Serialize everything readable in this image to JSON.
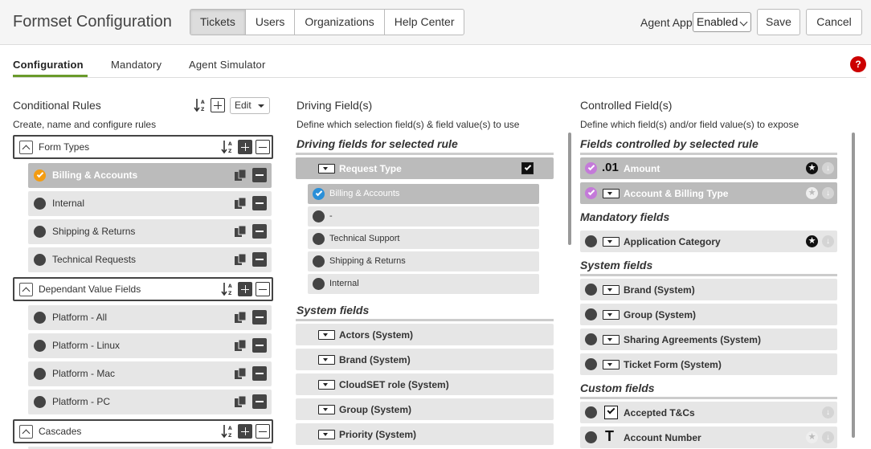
{
  "header": {
    "title": "Formset Configuration",
    "tabs": [
      {
        "label": "Tickets",
        "active": true
      },
      {
        "label": "Users"
      },
      {
        "label": "Organizations"
      },
      {
        "label": "Help Center"
      }
    ],
    "agent_app_label": "Agent App",
    "agent_app_value": "Enabled",
    "save_label": "Save",
    "cancel_label": "Cancel"
  },
  "subtabs": {
    "items": [
      "Configuration",
      "Mandatory",
      "Agent Simulator"
    ],
    "active": "Configuration",
    "help": "?"
  },
  "rules": {
    "title": "Conditional Rules",
    "subtitle": "Create, name and configure rules",
    "edit_label": "Edit",
    "sort_glyph": "A Z",
    "groups": [
      {
        "label": "Form Types",
        "items": [
          "Billing & Accounts",
          "Internal",
          "Shipping & Returns",
          "Technical Requests"
        ]
      },
      {
        "label": "Dependant Value Fields",
        "items": [
          "Platform - All",
          "Platform - Linux",
          "Platform - Mac",
          "Platform - PC"
        ]
      },
      {
        "label": "Cascades",
        "items": []
      }
    ]
  },
  "driving": {
    "title": "Driving Field(s)",
    "subtitle": "Define which selection field(s) & field value(s) to use",
    "selected_section": "Driving fields for selected rule",
    "request_type_label": "Request Type",
    "values": [
      "Billing & Accounts",
      "-",
      "Technical Support",
      "Shipping & Returns",
      "Internal"
    ],
    "system_section": "System fields",
    "system_fields": [
      "Actors (System)",
      "Brand (System)",
      "CloudSET role (System)",
      "Group (System)",
      "Priority (System)"
    ]
  },
  "controlled": {
    "title": "Controlled Field(s)",
    "subtitle": "Define which field(s) and/or field value(s) to expose",
    "selected_section": "Fields controlled by selected rule",
    "selected_fields": [
      {
        "label": "Amount",
        "type_glyph": ".01"
      },
      {
        "label": "Account & Billing Type"
      }
    ],
    "mandatory_section": "Mandatory fields",
    "mandatory_fields": [
      "Application Category"
    ],
    "system_section": "System fields",
    "system_fields": [
      "Brand (System)",
      "Group (System)",
      "Sharing Agreements (System)",
      "Ticket Form (System)"
    ],
    "custom_section": "Custom fields",
    "custom_fields": [
      {
        "label": "Accepted T&Cs"
      },
      {
        "label": "Account Number",
        "type_glyph": "T"
      }
    ]
  },
  "colors": {
    "accent_green": "#6a9a2b",
    "selected_orange": "#f39c12",
    "selected_blue": "#2a8fd8",
    "selected_purple": "#c47ad9",
    "help_red": "#cc0000"
  }
}
